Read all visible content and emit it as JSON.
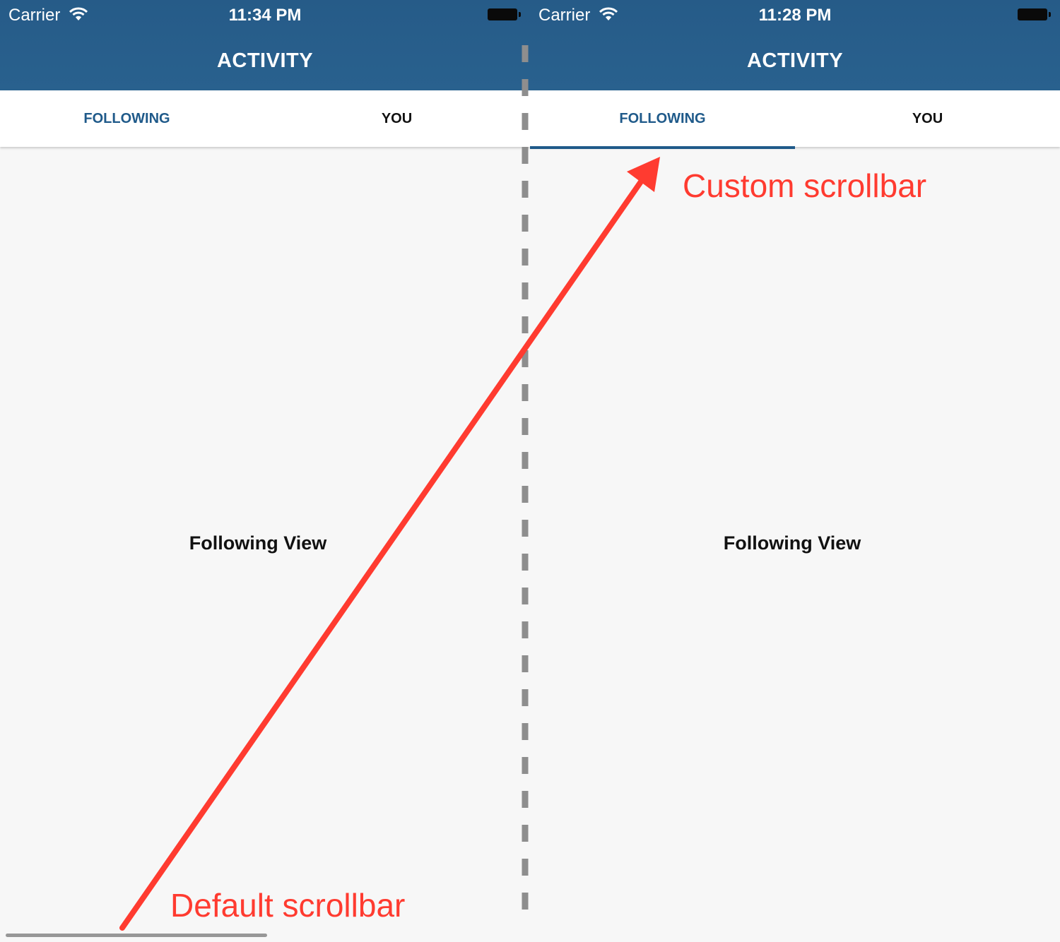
{
  "screens": [
    {
      "status": {
        "carrier": "Carrier",
        "time": "11:34 PM"
      },
      "nav_title": "ACTIVITY",
      "tabs": [
        {
          "label": "FOLLOWING",
          "active": true
        },
        {
          "label": "YOU",
          "active": false
        }
      ],
      "content_label": "Following View"
    },
    {
      "status": {
        "carrier": "Carrier",
        "time": "11:28 PM"
      },
      "nav_title": "ACTIVITY",
      "tabs": [
        {
          "label": "FOLLOWING",
          "active": true
        },
        {
          "label": "YOU",
          "active": false
        }
      ],
      "content_label": "Following View"
    }
  ],
  "annotations": {
    "custom": "Custom scrollbar",
    "default": "Default scrollbar",
    "color": "#ff3b30"
  },
  "colors": {
    "nav_bar": "#27608d",
    "active_tab_text": "#1f5a8a",
    "indicator": "#1f5a8a",
    "divider": "#8e8e8e"
  }
}
